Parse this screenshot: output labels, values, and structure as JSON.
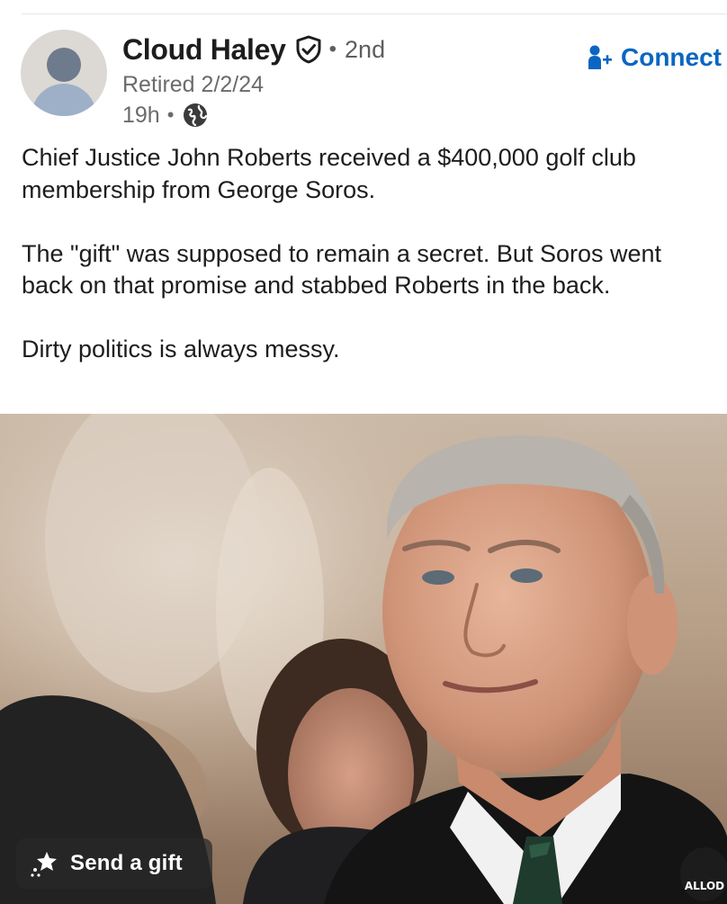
{
  "post": {
    "author": {
      "name": "Cloud Haley",
      "degree": "2nd",
      "headline": "Retired 2/2/24",
      "time": "19h",
      "separator": "•",
      "visibility_icon": "globe-icon",
      "verified_icon": "shield-check-icon"
    },
    "connect": {
      "label": "Connect",
      "icon": "add-person-icon",
      "color": "#0a66c2"
    },
    "text": [
      "Chief Justice John Roberts received a $400,000 golf club membership from George Soros.",
      "The \"gift\" was supposed to remain a secret. But Soros went back on that promise and stabbed Roberts in the back.",
      "Dirty politics is always messy."
    ],
    "image": {
      "gift_button": {
        "label": "Send a gift",
        "icon": "gift-sparkle-icon"
      },
      "watermark_text": "ALLOD"
    }
  }
}
